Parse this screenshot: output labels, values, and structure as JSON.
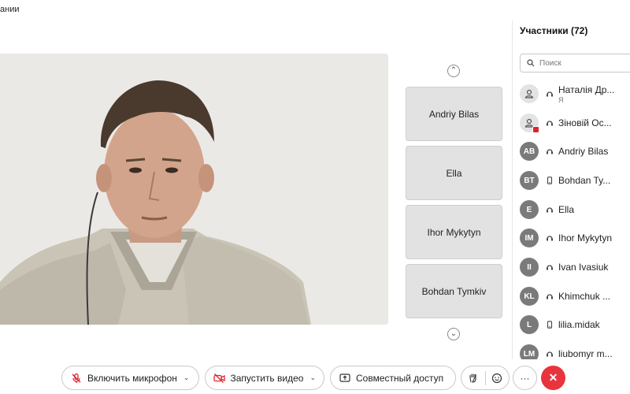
{
  "window": {
    "title_fragment": "ании"
  },
  "stage": {
    "navigation": {
      "up_icon": "chevron-up-icon",
      "down_icon": "chevron-down-icon"
    },
    "tiles": [
      "Andriy Bilas",
      "Ella",
      "Ihor Mykytyn",
      "Bohdan Tymkiv"
    ]
  },
  "participants": {
    "title": "Участники (72)",
    "search_placeholder": "Поиск",
    "list": [
      {
        "initials": "",
        "name": "Наталія Др...",
        "sub": "Я",
        "avatar": "person-icon",
        "status": "headset-icon"
      },
      {
        "initials": "",
        "name": "Зіновій Ос...",
        "sub": "",
        "avatar": "person-icon",
        "status": "headset-icon",
        "badge": true
      },
      {
        "initials": "AB",
        "name": "Andriy Bilas",
        "sub": "",
        "status": "headset-icon"
      },
      {
        "initials": "BT",
        "name": "Bohdan Ty...",
        "sub": "",
        "status": "phone-icon"
      },
      {
        "initials": "E",
        "name": "Ella",
        "sub": "",
        "status": "headset-icon"
      },
      {
        "initials": "IM",
        "name": "Ihor Mykytyn",
        "sub": "",
        "status": "headset-icon"
      },
      {
        "initials": "II",
        "name": "Ivan Ivasiuk",
        "sub": "",
        "status": "headset-icon"
      },
      {
        "initials": "KL",
        "name": "Khimchuk ...",
        "sub": "",
        "status": "headset-icon"
      },
      {
        "initials": "L",
        "name": "lilia.midak",
        "sub": "",
        "status": "phone-icon"
      },
      {
        "initials": "LM",
        "name": "liubomyr m...",
        "sub": "",
        "status": "headset-icon"
      }
    ]
  },
  "toolbar": {
    "mic_label": "Включить микрофон",
    "video_label": "Запустить видео",
    "share_label": "Совместный доступ",
    "more_label": "···",
    "end_label": "✕"
  },
  "colors": {
    "end_call": "#e8343c",
    "mute_red": "#e0242f",
    "avatar": "#7a7a7a"
  }
}
